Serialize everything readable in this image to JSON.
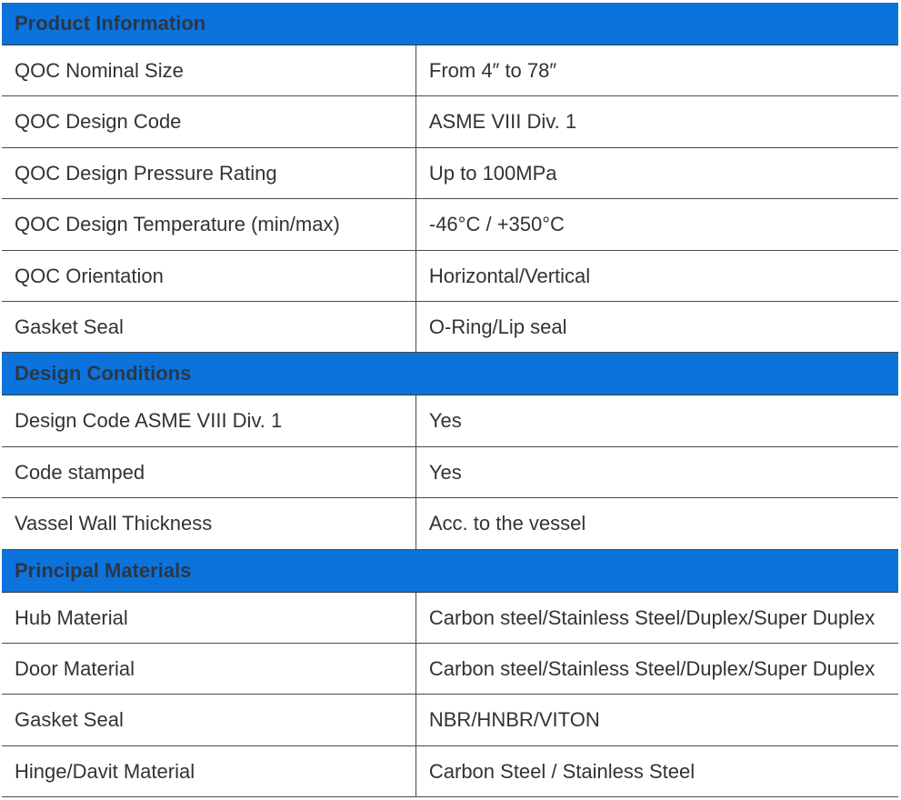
{
  "sections": [
    {
      "title": "Product Information",
      "rows": [
        {
          "label": "QOC Nominal Size",
          "value": "From 4″ to 78″"
        },
        {
          "label": "QOC Design Code",
          "value": "ASME VIII Div. 1"
        },
        {
          "label": "QOC Design Pressure Rating",
          "value": "Up to 100MPa"
        },
        {
          "label": "QOC Design Temperature (min/max)",
          "value": "-46°C / +350°C"
        },
        {
          "label": "QOC Orientation",
          "value": "Horizontal/Vertical"
        },
        {
          "label": "Gasket Seal",
          "value": "O-Ring/Lip seal"
        }
      ]
    },
    {
      "title": "Design Conditions",
      "rows": [
        {
          "label": "Design Code ASME VIII Div. 1",
          "value": "Yes"
        },
        {
          "label": "Code stamped",
          "value": "Yes"
        },
        {
          "label": "Vassel Wall Thickness",
          "value": "Acc. to the vessel"
        }
      ]
    },
    {
      "title": "Principal Materials",
      "rows": [
        {
          "label": "Hub Material",
          "value": "Carbon steel/Stainless Steel/Duplex/Super Duplex"
        },
        {
          "label": "Door Material",
          "value": "Carbon steel/Stainless Steel/Duplex/Super Duplex"
        },
        {
          "label": "Gasket Seal",
          "value": "NBR/HNBR/VITON"
        },
        {
          "label": "Hinge/Davit Material",
          "value": "Carbon Steel / Stainless Steel"
        }
      ]
    }
  ]
}
